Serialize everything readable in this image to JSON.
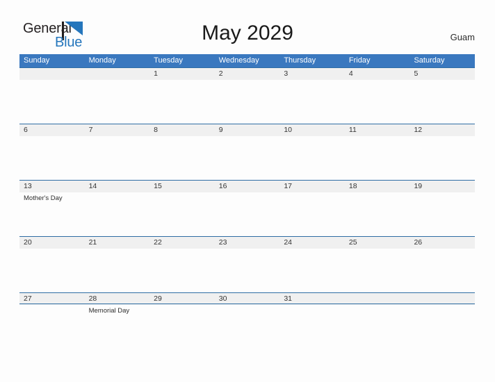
{
  "logo": {
    "word_one": "General",
    "word_two": "Blue",
    "flag_icon": "flag-triangle-icon",
    "flag_color": "#2576bc",
    "pole_color": "#231f20"
  },
  "header": {
    "title": "May 2029",
    "location": "Guam"
  },
  "theme": {
    "header_blue": "#3a78bf",
    "rule_blue": "#2e6da4",
    "band_gray": "#f0f0f0",
    "page_background": "#fdfdfd",
    "text_dark": "#333333"
  },
  "calendar": {
    "weekdays": [
      "Sunday",
      "Monday",
      "Tuesday",
      "Wednesday",
      "Thursday",
      "Friday",
      "Saturday"
    ],
    "weeks": [
      [
        {
          "day": "",
          "event": ""
        },
        {
          "day": "",
          "event": ""
        },
        {
          "day": "1",
          "event": ""
        },
        {
          "day": "2",
          "event": ""
        },
        {
          "day": "3",
          "event": ""
        },
        {
          "day": "4",
          "event": ""
        },
        {
          "day": "5",
          "event": ""
        }
      ],
      [
        {
          "day": "6",
          "event": ""
        },
        {
          "day": "7",
          "event": ""
        },
        {
          "day": "8",
          "event": ""
        },
        {
          "day": "9",
          "event": ""
        },
        {
          "day": "10",
          "event": ""
        },
        {
          "day": "11",
          "event": ""
        },
        {
          "day": "12",
          "event": ""
        }
      ],
      [
        {
          "day": "13",
          "event": "Mother's Day"
        },
        {
          "day": "14",
          "event": ""
        },
        {
          "day": "15",
          "event": ""
        },
        {
          "day": "16",
          "event": ""
        },
        {
          "day": "17",
          "event": ""
        },
        {
          "day": "18",
          "event": ""
        },
        {
          "day": "19",
          "event": ""
        }
      ],
      [
        {
          "day": "20",
          "event": ""
        },
        {
          "day": "21",
          "event": ""
        },
        {
          "day": "22",
          "event": ""
        },
        {
          "day": "23",
          "event": ""
        },
        {
          "day": "24",
          "event": ""
        },
        {
          "day": "25",
          "event": ""
        },
        {
          "day": "26",
          "event": ""
        }
      ],
      [
        {
          "day": "27",
          "event": ""
        },
        {
          "day": "28",
          "event": "Memorial Day"
        },
        {
          "day": "29",
          "event": ""
        },
        {
          "day": "30",
          "event": ""
        },
        {
          "day": "31",
          "event": ""
        },
        {
          "day": "",
          "event": ""
        },
        {
          "day": "",
          "event": ""
        }
      ]
    ]
  }
}
